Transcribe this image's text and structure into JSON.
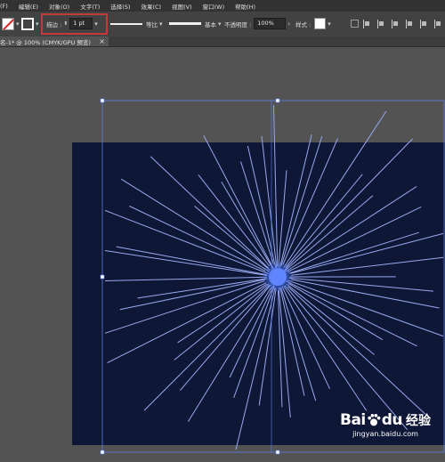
{
  "menu": [
    "(F)",
    "编辑(E)",
    "对象(O)",
    "文字(T)",
    "选择(S)",
    "效果(C)",
    "视图(V)",
    "窗口(W)",
    "帮助(H)"
  ],
  "controls": {
    "stroke_label": "描边 :",
    "stroke_value": "1 pt",
    "profile_label": "等比",
    "brush_label": "基本",
    "opacity_label": "不透明度 :",
    "opacity_value": "100%",
    "style_label": "样式 :"
  },
  "tab": {
    "title": "名-1* @ 100% (CMYK/GPU 预览)",
    "close": "×"
  },
  "colors": {
    "artboard": "#0f1736",
    "rays": "#98a9ee",
    "center_glow": "#5f86ff",
    "selection": "#5a7fe8",
    "highlight": "#c23b3b"
  },
  "watermark": {
    "logo": "Bai",
    "logo2": "du",
    "cn": "经验",
    "url": "jingyan.baidu.com"
  }
}
